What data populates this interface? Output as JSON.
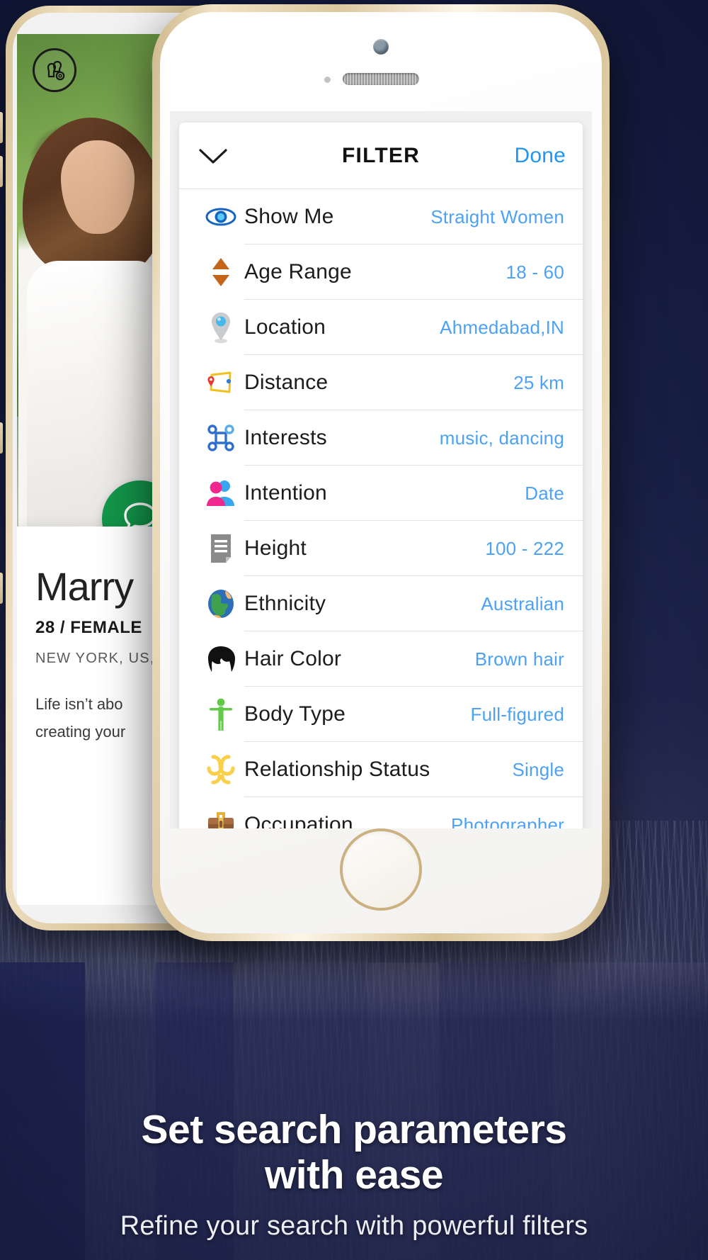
{
  "background": {
    "scene": "blurred-night-field"
  },
  "back_phone": {
    "avatar_icon": "users-settings-icon",
    "chat_icon": "chat-bubble-icon",
    "profile": {
      "name": "Marry",
      "meta": "28 / FEMALE",
      "location": "NEW YORK, US,",
      "bio_line1": "Life isn’t abo",
      "bio_line2": "creating your"
    }
  },
  "front_phone": {
    "filter": {
      "header": {
        "collapse_icon": "chevron-down-icon",
        "title": "FILTER",
        "done_label": "Done",
        "accent_color": "#2196f3"
      },
      "value_color": "#4da2f5",
      "rows": [
        {
          "icon": "eye-icon",
          "label": "Show Me",
          "value": "Straight Women"
        },
        {
          "icon": "age-updown-icon",
          "label": "Age Range",
          "value": "18 - 60"
        },
        {
          "icon": "map-pin-icon",
          "label": "Location",
          "value": "Ahmedabad,IN"
        },
        {
          "icon": "route-distance-icon",
          "label": "Distance",
          "value": "25 km"
        },
        {
          "icon": "interests-icon",
          "label": "Interests",
          "value": "music, dancing"
        },
        {
          "icon": "two-people-icon",
          "label": "Intention",
          "value": "Date"
        },
        {
          "icon": "document-icon",
          "label": "Height",
          "value": "100 - 222"
        },
        {
          "icon": "globe-icon",
          "label": "Ethnicity",
          "value": "Australian"
        },
        {
          "icon": "hair-icon",
          "label": "Hair Color",
          "value": "Brown hair"
        },
        {
          "icon": "body-person-icon",
          "label": "Body Type",
          "value": "Full-figured"
        },
        {
          "icon": "knot-icon",
          "label": "Relationship Status",
          "value": "Single"
        },
        {
          "icon": "briefcase-icon",
          "label": "Occupation",
          "value": "Photographer"
        }
      ]
    }
  },
  "caption": {
    "headline_line1": "Set search parameters",
    "headline_line2": "with ease",
    "subtitle": "Refine your search with powerful filters"
  }
}
